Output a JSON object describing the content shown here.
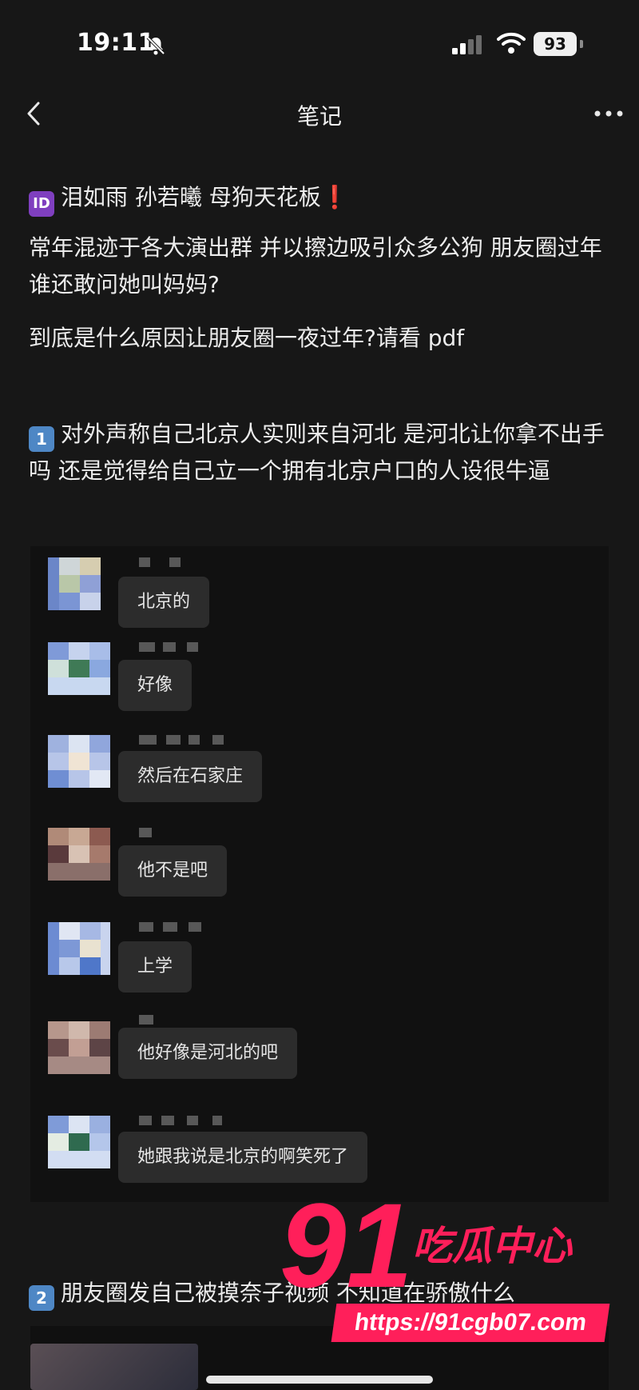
{
  "status_bar": {
    "time": "19:11",
    "battery": "93",
    "icons": [
      "bell-slash-icon",
      "cellular-signal-icon",
      "wifi-icon",
      "battery-icon"
    ]
  },
  "header": {
    "title": "笔记",
    "back_icon": "chevron-left-icon",
    "more_icon": "more-horizontal-icon"
  },
  "post": {
    "headline_badge": "ID",
    "headline": "泪如雨 孙若曦 母狗天花板",
    "headline_mark": "❗",
    "intro": "常年混迹于各大演出群 并以擦边吸引众多公狗 朋友圈过年 谁还敢问她叫妈妈?",
    "question": "到底是什么原因让朋友圈一夜过年?请看 pdf",
    "section1_num": "1",
    "section1": "对外声称自己北京人实则来自河北 是河北让你拿不出手吗 还是觉得给自己立一个拥有北京户口的人设很牛逼",
    "section2_num": "2",
    "section2": "朋友圈发自己被摸奈子视频 不知道在骄傲什么"
  },
  "chat": {
    "messages": [
      {
        "text": "北京的"
      },
      {
        "text": "好像"
      },
      {
        "text": "然后在石家庄"
      },
      {
        "text": "他不是吧"
      },
      {
        "text": "上学"
      },
      {
        "text": "他好像是河北的吧"
      },
      {
        "text": "她跟我说是北京的啊笑死了"
      }
    ]
  },
  "watermark": {
    "number": "91",
    "name": "吃瓜中心",
    "url": "https://91cgb07.com"
  },
  "colors": {
    "background": "#171717",
    "bubble": "#2c2c2c",
    "watermark": "#ff1f5a",
    "badge_purple": "#7f3fbf",
    "badge_blue": "#4e87c5"
  }
}
